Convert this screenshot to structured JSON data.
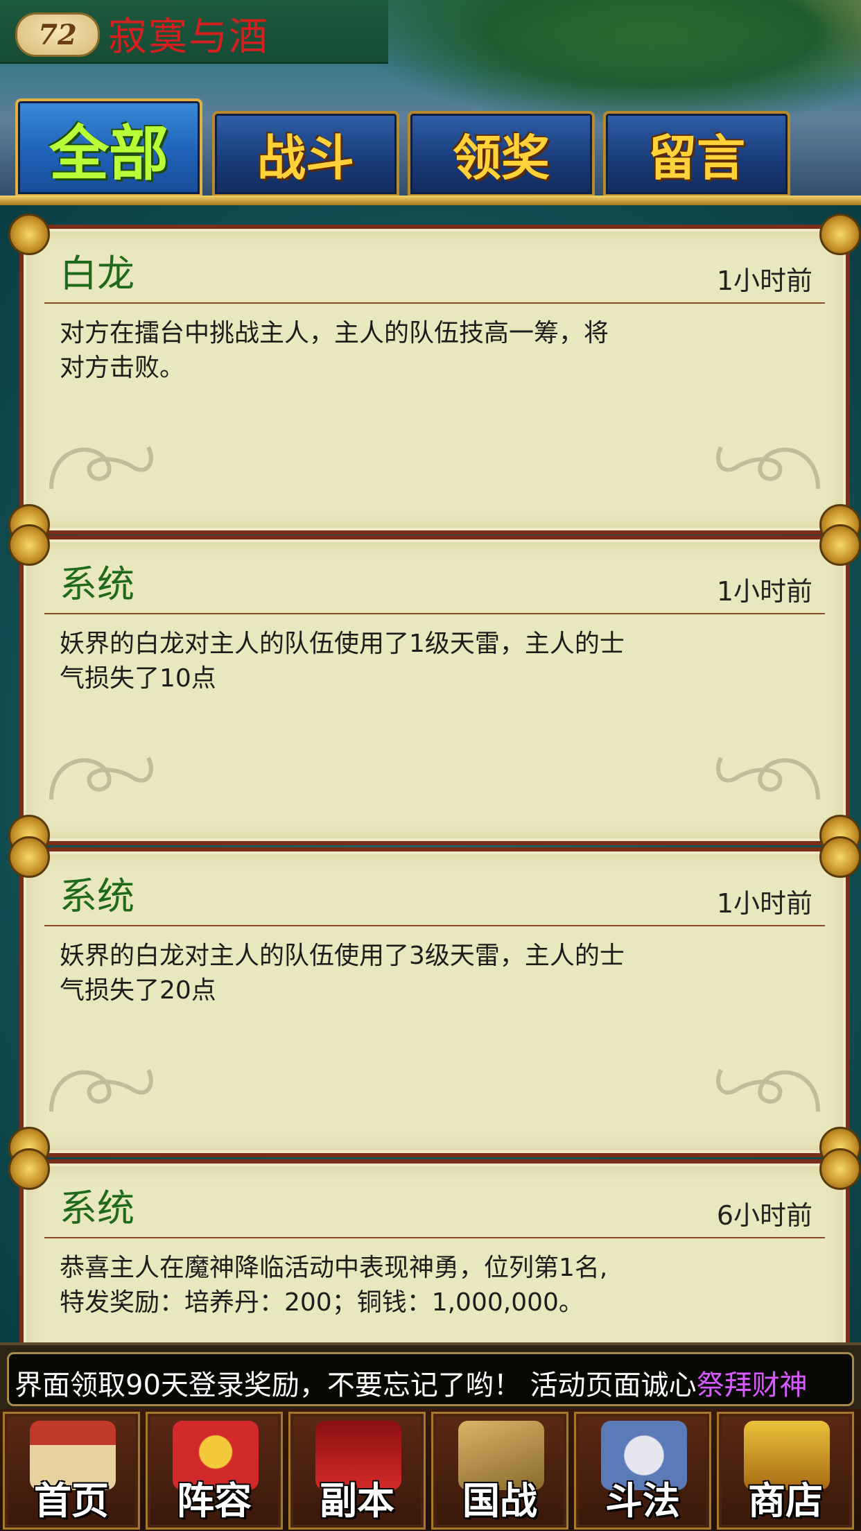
{
  "header": {
    "level": "72",
    "player_name": "寂寞与酒"
  },
  "tabs": [
    {
      "label": "全部",
      "active": true
    },
    {
      "label": "战斗",
      "active": false
    },
    {
      "label": "领奖",
      "active": false
    },
    {
      "label": "留言",
      "active": false
    }
  ],
  "messages": [
    {
      "sender": "白龙",
      "time": "1小时前",
      "text": "对方在擂台中挑战主人，主人的队伍技高一筹，将对方击败。"
    },
    {
      "sender": "系统",
      "time": "1小时前",
      "text": "妖界的白龙对主人的队伍使用了1级天雷，主人的士气损失了10点"
    },
    {
      "sender": "系统",
      "time": "1小时前",
      "text": "妖界的白龙对主人的队伍使用了3级天雷，主人的士气损失了20点"
    },
    {
      "sender": "系统",
      "time": "6小时前",
      "text": "恭喜主人在魔神降临活动中表现神勇，位列第1名,特发奖励：培养丹：200；铜钱：1,000,000。"
    }
  ],
  "ticker": {
    "text": "界面领取90天登录奖励，不要忘记了哟！ 活动页面诚心",
    "highlight": "祭拜财神"
  },
  "nav": [
    {
      "label": "首页",
      "icon": "home-palace-icon"
    },
    {
      "label": "阵容",
      "icon": "lineup-scroll-icon"
    },
    {
      "label": "副本",
      "icon": "dungeon-flag-icon"
    },
    {
      "label": "国战",
      "icon": "war-map-icon"
    },
    {
      "label": "斗法",
      "icon": "crossed-swords-icon"
    },
    {
      "label": "商店",
      "icon": "treasure-chest-icon"
    }
  ]
}
